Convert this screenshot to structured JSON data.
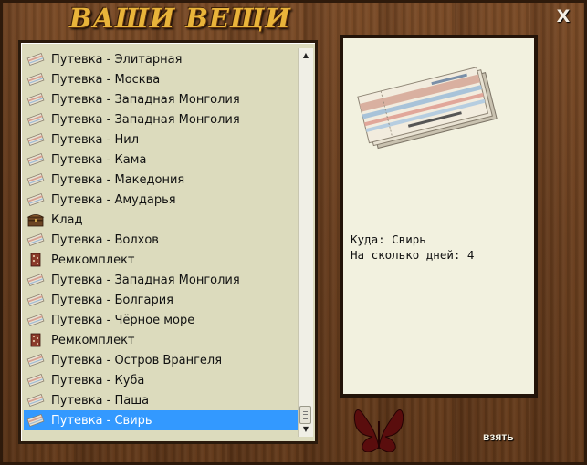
{
  "window": {
    "title": "ВАШИ ВЕЩИ",
    "close_label": "X"
  },
  "list": {
    "items": [
      {
        "label": "Путевка - Элитарная",
        "icon": "ticket-icon"
      },
      {
        "label": "Путевка - Москва",
        "icon": "ticket-icon"
      },
      {
        "label": "Путевка - Западная Монголия",
        "icon": "ticket-icon"
      },
      {
        "label": "Путевка - Западная Монголия",
        "icon": "ticket-icon"
      },
      {
        "label": "Путевка - Нил",
        "icon": "ticket-icon"
      },
      {
        "label": "Путевка - Кама",
        "icon": "ticket-icon"
      },
      {
        "label": "Путевка - Македония",
        "icon": "ticket-icon"
      },
      {
        "label": "Путевка - Амударья",
        "icon": "ticket-icon"
      },
      {
        "label": "Клад",
        "icon": "treasure-chest-icon"
      },
      {
        "label": "Путевка - Волхов",
        "icon": "ticket-icon"
      },
      {
        "label": "Ремкомплект",
        "icon": "repair-kit-icon"
      },
      {
        "label": "Путевка - Западная Монголия",
        "icon": "ticket-icon"
      },
      {
        "label": "Путевка - Болгария",
        "icon": "ticket-icon"
      },
      {
        "label": "Путевка - Чёрное море",
        "icon": "ticket-icon"
      },
      {
        "label": "Ремкомплект",
        "icon": "repair-kit-icon"
      },
      {
        "label": "Путевка - Остров Врангеля",
        "icon": "ticket-icon"
      },
      {
        "label": "Путевка - Куба",
        "icon": "ticket-icon"
      },
      {
        "label": "Путевка - Паша",
        "icon": "ticket-icon"
      },
      {
        "label": "Путевка - Свирь",
        "icon": "ticket-icon",
        "selected": true
      }
    ]
  },
  "detail": {
    "line1": "Куда: Свирь",
    "line2": "На сколько дней: 4"
  },
  "actions": {
    "take_label": "взять"
  },
  "colors": {
    "selection": "#3399ff",
    "title": "#e9b43a",
    "butterfly": "#5a0d0d"
  }
}
